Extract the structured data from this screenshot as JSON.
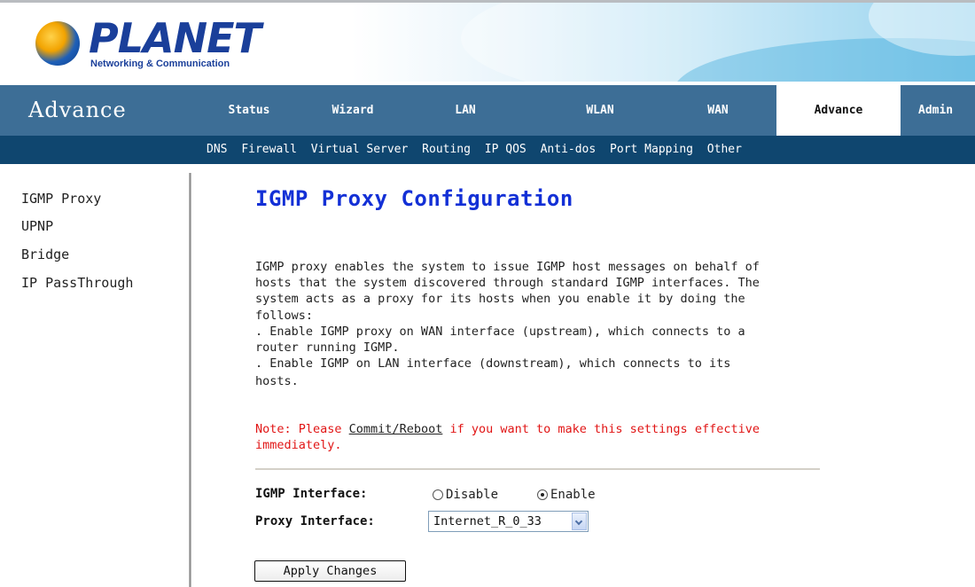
{
  "brand": {
    "name": "PLANET",
    "tagline": "Networking & Communication"
  },
  "nav": {
    "section_title": "Advance",
    "tabs": [
      {
        "label": "Status"
      },
      {
        "label": "Wizard"
      },
      {
        "label": "LAN"
      },
      {
        "label": "WLAN"
      },
      {
        "label": "WAN"
      },
      {
        "label": "Advance",
        "active": true
      },
      {
        "label": "Admin"
      }
    ],
    "subtabs": [
      "DNS",
      "Firewall",
      "Virtual Server",
      "Routing",
      "IP QOS",
      "Anti-dos",
      "Port Mapping",
      "Other"
    ]
  },
  "sidebar": {
    "items": [
      "IGMP Proxy",
      "UPNP",
      "Bridge",
      "IP PassThrough"
    ]
  },
  "content": {
    "title": "IGMP Proxy Configuration",
    "description_lines": [
      "IGMP proxy enables the system to issue IGMP host messages on behalf of",
      "hosts that the system discovered through standard IGMP interfaces. The",
      "system acts as a proxy for its hosts when you enable it by doing the",
      "follows:",
      ". Enable IGMP proxy on WAN interface (upstream), which connects to a",
      "router running IGMP.",
      ". Enable IGMP on LAN interface (downstream), which connects to its",
      "hosts."
    ],
    "note_prefix": "Note: Please ",
    "note_link": "Commit/Reboot",
    "note_suffix": " if you want to make this settings effective",
    "note_line2": "immediately.",
    "igmp_interface_label": "IGMP Interface:",
    "radio_disable_label": "Disable",
    "radio_enable_label": "Enable",
    "radio_selected": "Enable",
    "proxy_interface_label": "Proxy Interface:",
    "proxy_interface_value": "Internet_R_0_33",
    "apply_button": "Apply Changes"
  },
  "colors": {
    "nav_bg": "#3d6e96",
    "subnav_bg": "#0f466f",
    "title": "#1330d6",
    "note": "#e11515"
  }
}
